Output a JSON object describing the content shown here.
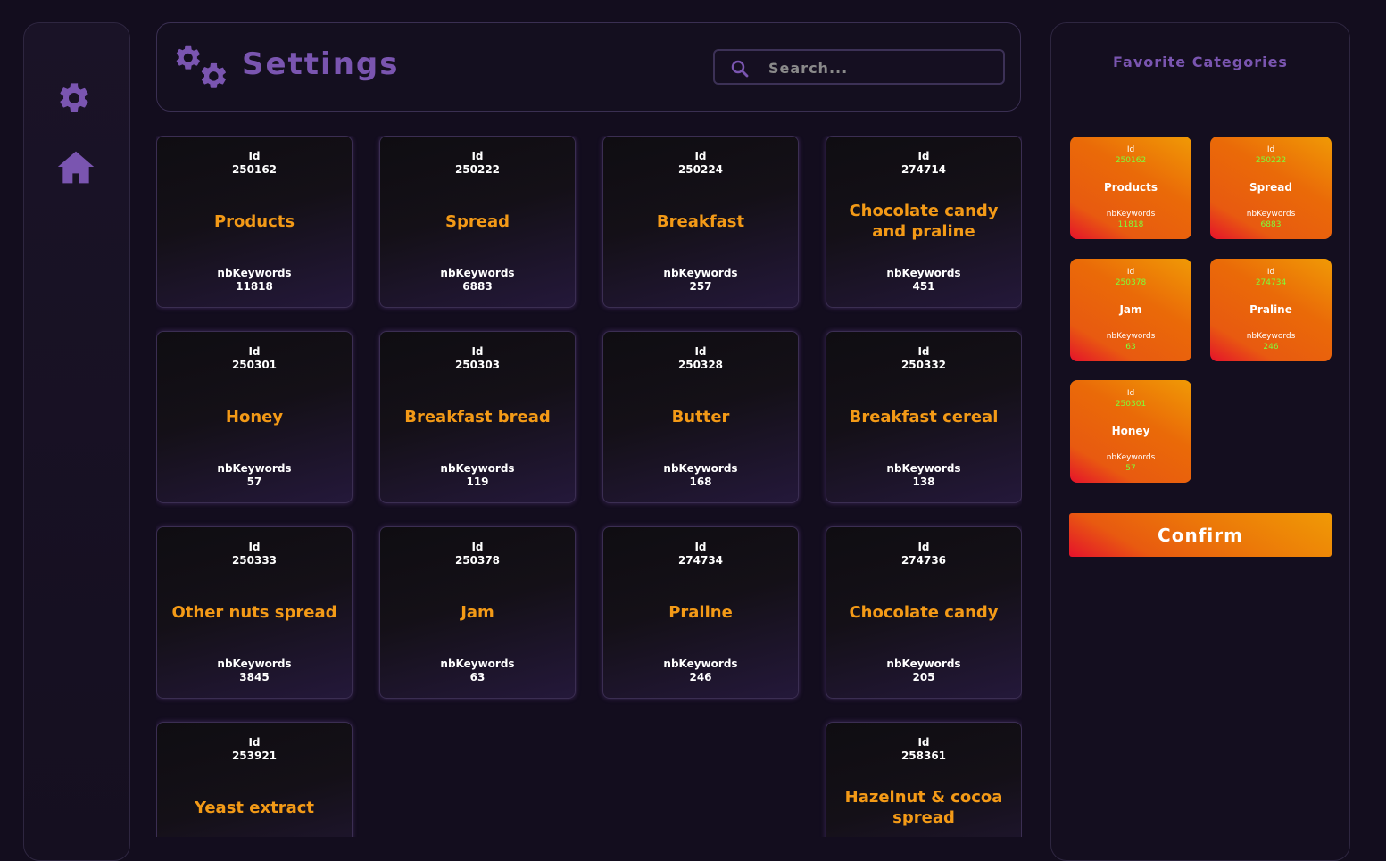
{
  "header": {
    "title": "Settings",
    "search_placeholder": "Search..."
  },
  "sidebar": {
    "items": [
      {
        "icon": "gear-icon"
      },
      {
        "icon": "home-icon"
      }
    ]
  },
  "colors": {
    "accent_purple": "#7a55b0",
    "category_orange": "#f39a17",
    "fav_green": "#7dff3a"
  },
  "labels": {
    "id": "Id",
    "keywords": "nbKeywords"
  },
  "categories": [
    {
      "id": "250162",
      "name": "Products",
      "keywords": "11818"
    },
    {
      "id": "250222",
      "name": "Spread",
      "keywords": "6883"
    },
    {
      "id": "250224",
      "name": "Breakfast",
      "keywords": "257"
    },
    {
      "id": "274714",
      "name": "Chocolate candy and praline",
      "keywords": "451"
    },
    {
      "id": "250301",
      "name": "Honey",
      "keywords": "57"
    },
    {
      "id": "250303",
      "name": "Breakfast bread",
      "keywords": "119"
    },
    {
      "id": "250328",
      "name": "Butter",
      "keywords": "168"
    },
    {
      "id": "250332",
      "name": "Breakfast cereal",
      "keywords": "138"
    },
    {
      "id": "250333",
      "name": "Other nuts spread",
      "keywords": "3845"
    },
    {
      "id": "250378",
      "name": "Jam",
      "keywords": "63"
    },
    {
      "id": "274734",
      "name": "Praline",
      "keywords": "246"
    },
    {
      "id": "274736",
      "name": "Chocolate candy",
      "keywords": "205"
    },
    {
      "id": "253921",
      "name": "Yeast extract",
      "keywords": ""
    },
    {
      "id": "258361",
      "name": "Hazelnut & cocoa spread",
      "keywords": ""
    }
  ],
  "favorites": {
    "title": "Favorite Categories",
    "items": [
      {
        "id": "250162",
        "name": "Products",
        "keywords": "11818"
      },
      {
        "id": "250222",
        "name": "Spread",
        "keywords": "6883"
      },
      {
        "id": "250378",
        "name": "Jam",
        "keywords": "63"
      },
      {
        "id": "274734",
        "name": "Praline",
        "keywords": "246"
      },
      {
        "id": "250301",
        "name": "Honey",
        "keywords": "57"
      }
    ],
    "confirm_label": "Confirm"
  }
}
